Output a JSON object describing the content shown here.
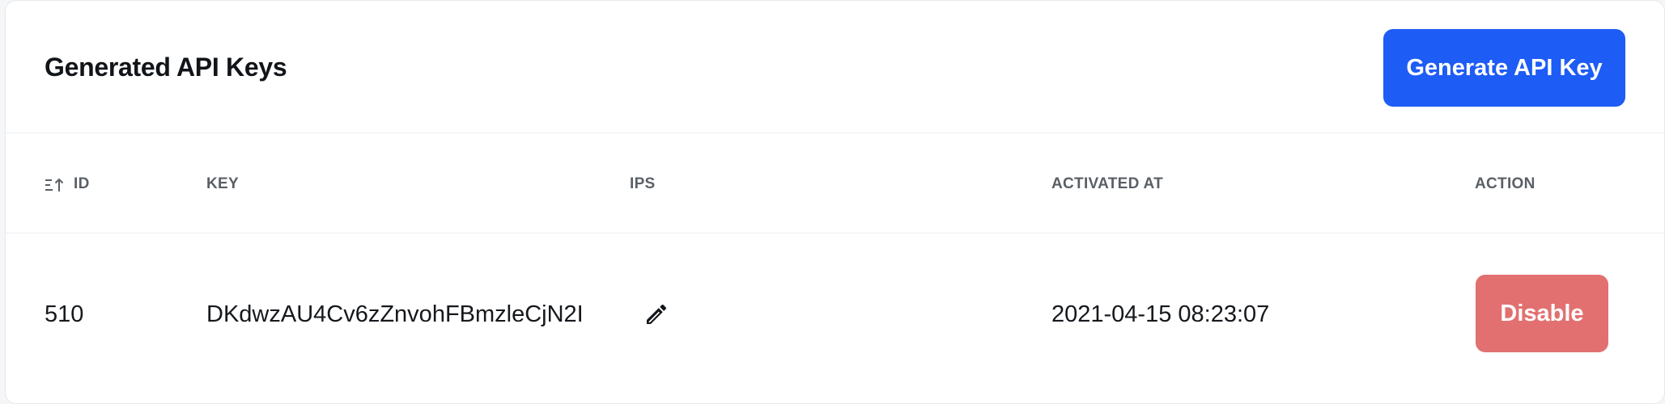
{
  "panel": {
    "title": "Generated API Keys",
    "generate_button": "Generate API Key"
  },
  "table": {
    "columns": {
      "id": "ID",
      "key": "KEY",
      "ips": "IPS",
      "activated_at": "ACTIVATED AT",
      "action": "ACTION"
    },
    "sort_icon": "sort-ascending-icon",
    "rows": [
      {
        "id": "510",
        "key": "DKdwzAU4Cv6zZnvohFBmzleCjN2I",
        "ips_icon": "pencil-icon",
        "activated_at": "2021-04-15 08:23:07",
        "action_label": "Disable"
      }
    ]
  },
  "colors": {
    "primary": "#1d5cf5",
    "danger": "#e27070",
    "header_text": "#5a5f66"
  }
}
